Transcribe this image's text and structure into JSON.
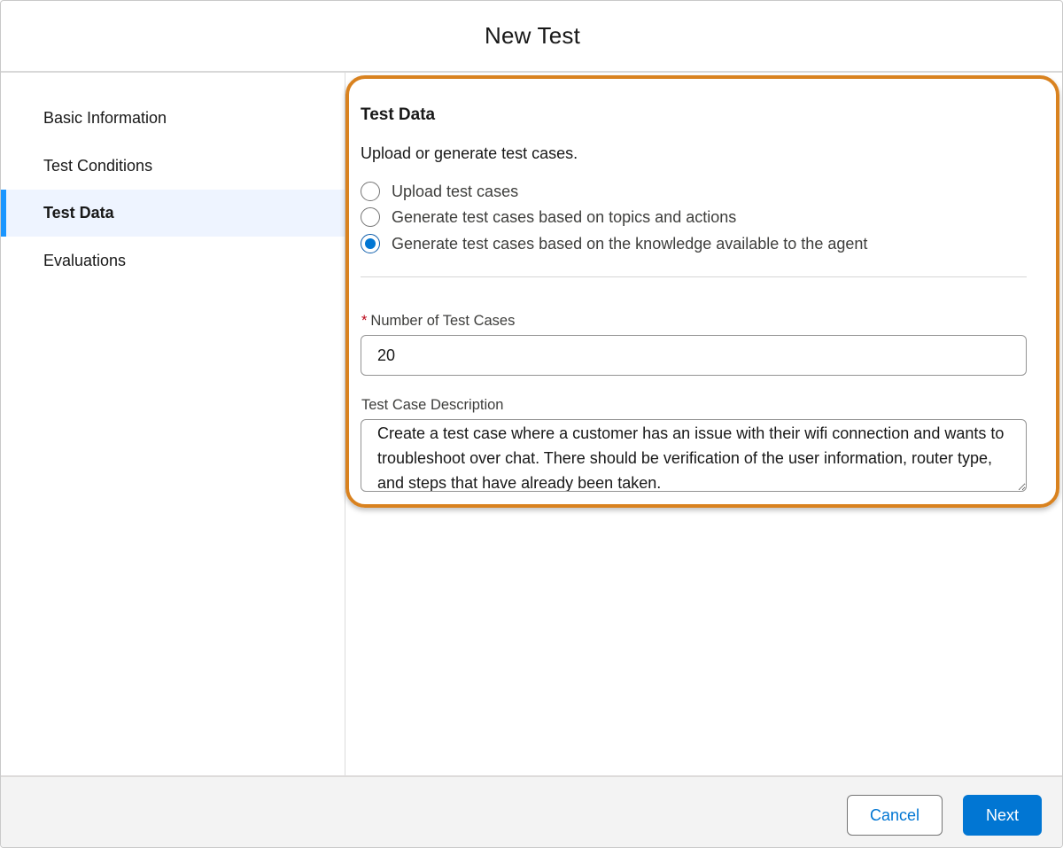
{
  "modal": {
    "title": "New Test"
  },
  "sidebar": {
    "items": [
      {
        "label": "Basic Information",
        "active": false
      },
      {
        "label": "Test Conditions",
        "active": false
      },
      {
        "label": "Test Data",
        "active": true
      },
      {
        "label": "Evaluations",
        "active": false
      }
    ]
  },
  "test_data": {
    "title": "Test Data",
    "description": "Upload or generate test cases.",
    "options": [
      {
        "label": "Upload test cases",
        "selected": false
      },
      {
        "label": "Generate test cases based on topics and actions",
        "selected": false
      },
      {
        "label": "Generate test cases based on the knowledge available to the agent",
        "selected": true
      }
    ],
    "num_cases": {
      "required_mark": "*",
      "label": "Number of Test Cases",
      "value": "20"
    },
    "case_description": {
      "label": "Test Case Description",
      "value": "Create a test case where a customer has an issue with their wifi connection and wants to troubleshoot over chat. There should be verification of the user information, router type, and steps that have already been taken."
    }
  },
  "footer": {
    "cancel_label": "Cancel",
    "next_label": "Next"
  },
  "colors": {
    "brand_blue": "#0176d3",
    "active_nav_bar": "#1b96ff",
    "highlight_orange": "#d9821f",
    "required_red": "#ba0517"
  }
}
